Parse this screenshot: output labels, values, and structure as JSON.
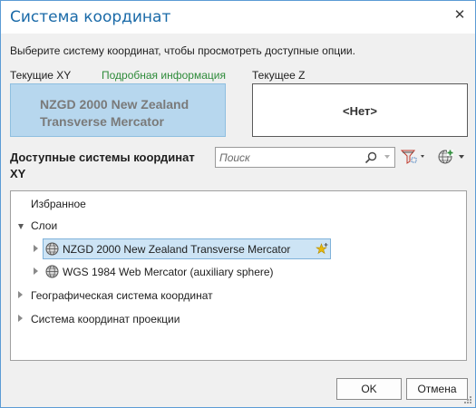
{
  "dialog": {
    "title": "Система координат",
    "close_glyph": "✕",
    "instruction": "Выберите систему координат, чтобы просмотреть доступные опции."
  },
  "current_xy": {
    "label": "Текущие XY",
    "details_link": "Подробная информация",
    "value": "NZGD 2000 New Zealand Transverse Mercator"
  },
  "current_z": {
    "label": "Текущее Z",
    "value": "<Нет>"
  },
  "available": {
    "heading": "Доступные системы координат XY",
    "search_placeholder": "Поиск"
  },
  "tree": {
    "favorites": "Избранное",
    "layers": "Слои",
    "layer_items": [
      "NZGD 2000 New Zealand Transverse Mercator",
      "WGS 1984 Web Mercator (auxiliary sphere)"
    ],
    "geographic": "Географическая система координат",
    "projected": "Система координат проекции"
  },
  "buttons": {
    "ok": "OK",
    "cancel": "Отмена"
  },
  "colors": {
    "accent": "#1a6aa8",
    "link": "#2e8b3a",
    "selection": "#cde4f5",
    "current_xy_bg": "#b7d7ee"
  },
  "icons": [
    "close-icon",
    "search-icon",
    "filter-icon",
    "globe-add-icon",
    "globe-icon",
    "favorite-star-icon",
    "resize-grip-icon"
  ]
}
